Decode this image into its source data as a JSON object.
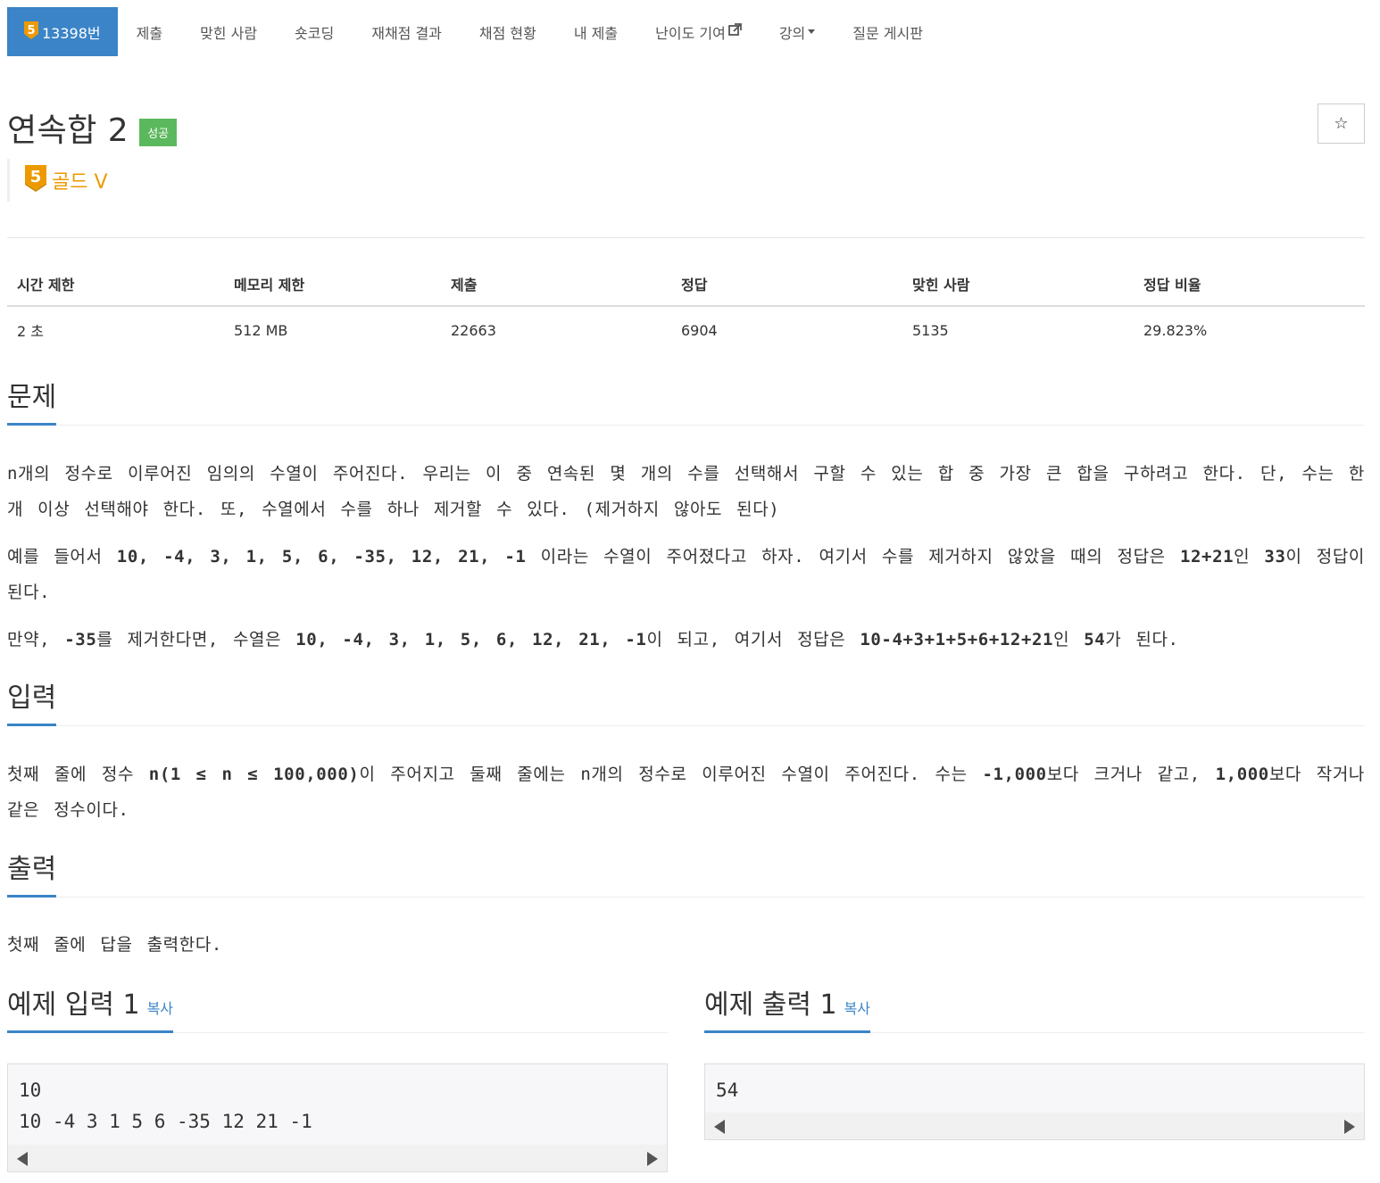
{
  "nav": {
    "problem_number": "13398번",
    "tier_digit": "5",
    "items": [
      "제출",
      "맞힌 사람",
      "숏코딩",
      "재채점 결과",
      "채점 현황",
      "내 제출",
      "난이도 기여",
      "강의",
      "질문 게시판"
    ]
  },
  "problem": {
    "title": "연속합 2",
    "status": "성공",
    "star": "☆",
    "tier_digit": "5",
    "tier": "골드 V"
  },
  "info_table": {
    "headers": [
      "시간 제한",
      "메모리 제한",
      "제출",
      "정답",
      "맞힌 사람",
      "정답 비율"
    ],
    "values": [
      "2 초",
      "512 MB",
      "22663",
      "6904",
      "5135",
      "29.823%"
    ]
  },
  "sections": {
    "problem": {
      "heading": "문제",
      "p1": "n개의 정수로 이루어진 임의의 수열이 주어진다. 우리는 이 중 연속된 몇 개의 수를 선택해서 구할 수 있는 합 중 가장 큰 합을 구하려고 한다. 단, 수는 한 개 이상 선택해야 한다. 또, 수열에서 수를 하나 제거할 수 있다. (제거하지 않아도 된다)",
      "p2_a": "예를 들어서 ",
      "p2_b": "10, -4, 3, 1, 5, 6, -35, 12, 21, -1",
      "p2_c": " 이라는 수열이 주어졌다고 하자. 여기서 수를 제거하지 않았을 때의 정답은 ",
      "p2_d": "12+21",
      "p2_e": "인 ",
      "p2_f": "33",
      "p2_g": "이 정답이 된다.",
      "p3_a": "만약, ",
      "p3_b": "-35",
      "p3_c": "를 제거한다면, 수열은 ",
      "p3_d": "10, -4, 3, 1, 5, 6, 12, 21, -1",
      "p3_e": "이 되고, 여기서 정답은 ",
      "p3_f": "10-4+3+1+5+6+12+21",
      "p3_g": "인 ",
      "p3_h": "54",
      "p3_i": "가 된다."
    },
    "input": {
      "heading": "입력",
      "a": "첫째 줄에 정수 ",
      "b": "n(1 ≤ n ≤ 100,000)",
      "c": "이 주어지고 둘째 줄에는 n개의 정수로 이루어진 수열이 주어진다. 수는 ",
      "d": "-1,000",
      "e": "보다 크거나 같고, ",
      "f": "1,000",
      "g": "보다 작거나 같은 정수이다."
    },
    "output": {
      "heading": "출력",
      "text": "첫째 줄에 답을 출력한다."
    }
  },
  "samples": {
    "input_heading": "예제 입력 1",
    "output_heading": "예제 출력 1",
    "copy": "복사",
    "input_text": "10\n10 -4 3 1 5 6 -35 12 21 -1",
    "output_text": "54"
  },
  "colors": {
    "accent": "#3a84c7",
    "success": "#5cb85c",
    "gold": "#ec9a00"
  }
}
